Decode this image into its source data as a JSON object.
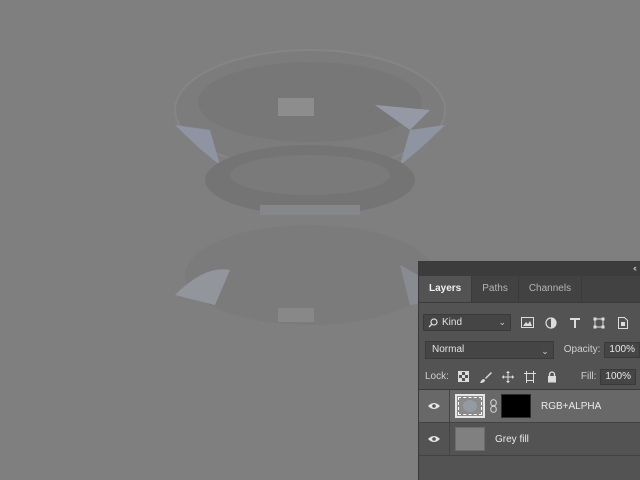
{
  "panel": {
    "collapse_glyph": "‹‹",
    "tabs": [
      {
        "label": "Layers",
        "active": true
      },
      {
        "label": "Paths",
        "active": false
      },
      {
        "label": "Channels",
        "active": false
      }
    ],
    "filter": {
      "kind_label": "Kind",
      "icons": [
        "image-filter-icon",
        "adjustment-filter-icon",
        "type-filter-icon",
        "shape-filter-icon",
        "smart-object-filter-icon"
      ]
    },
    "blend_mode": "Normal",
    "opacity_label": "Opacity:",
    "opacity_value": "100%",
    "lock_label": "Lock:",
    "lock_icons": [
      "lock-transparent-icon",
      "lock-paint-icon",
      "lock-position-icon",
      "lock-artboard-icon",
      "lock-all-icon"
    ],
    "fill_label": "Fill:",
    "fill_value": "100%",
    "layers": [
      {
        "name": "RGB+ALPHA",
        "selected": true,
        "has_mask": true
      },
      {
        "name": "Grey fill",
        "selected": false,
        "has_mask": false
      }
    ]
  },
  "colors": {
    "canvas": "#7f7f7f",
    "panel": "#535353",
    "selected_row": "#686868"
  }
}
